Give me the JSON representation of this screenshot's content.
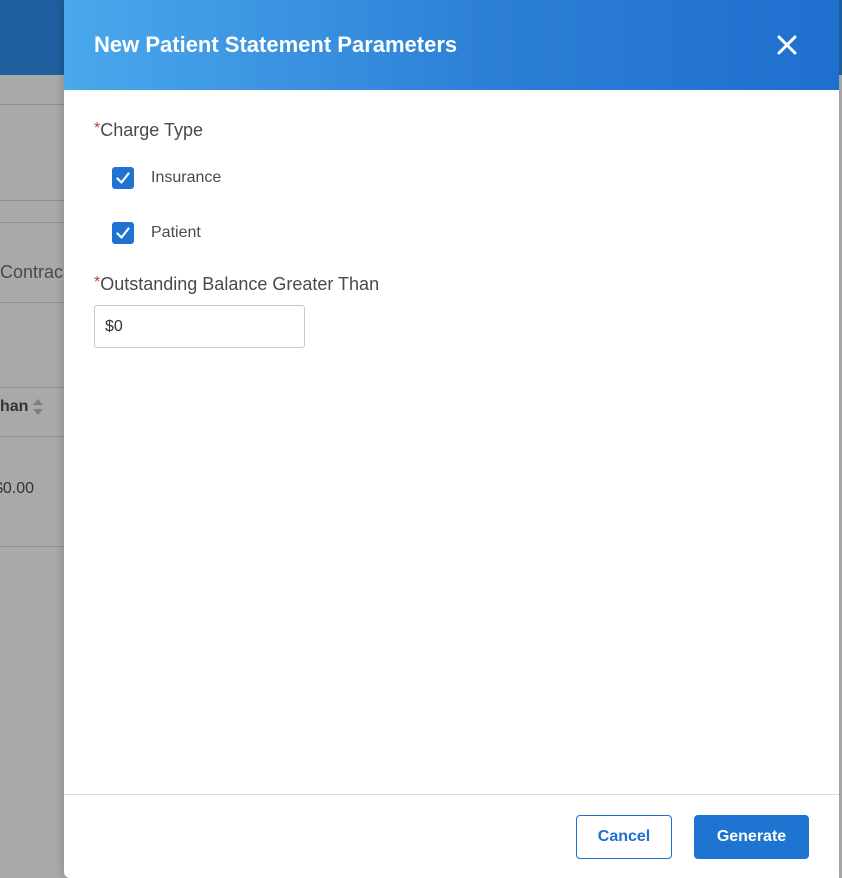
{
  "background": {
    "contract_text": "Contrac",
    "column_header": "han",
    "cell_value": "$0.00"
  },
  "modal": {
    "title": "New Patient Statement Parameters",
    "required_marker": "*",
    "charge_type": {
      "label": "Charge Type",
      "options": [
        {
          "label": "Insurance",
          "checked": true
        },
        {
          "label": "Patient",
          "checked": true
        }
      ]
    },
    "balance": {
      "label": "Outstanding Balance Greater Than",
      "value": "$0"
    },
    "buttons": {
      "cancel": "Cancel",
      "generate": "Generate"
    }
  },
  "colors": {
    "header_start": "#4aa8ec",
    "header_end": "#1f6fcf",
    "primary": "#1f74d2",
    "required": "#c23934",
    "overlay": "#a9a9a9"
  },
  "icons": {
    "close": "close-icon",
    "checkbox": "checkmark-icon",
    "sort": "sort-icon"
  }
}
